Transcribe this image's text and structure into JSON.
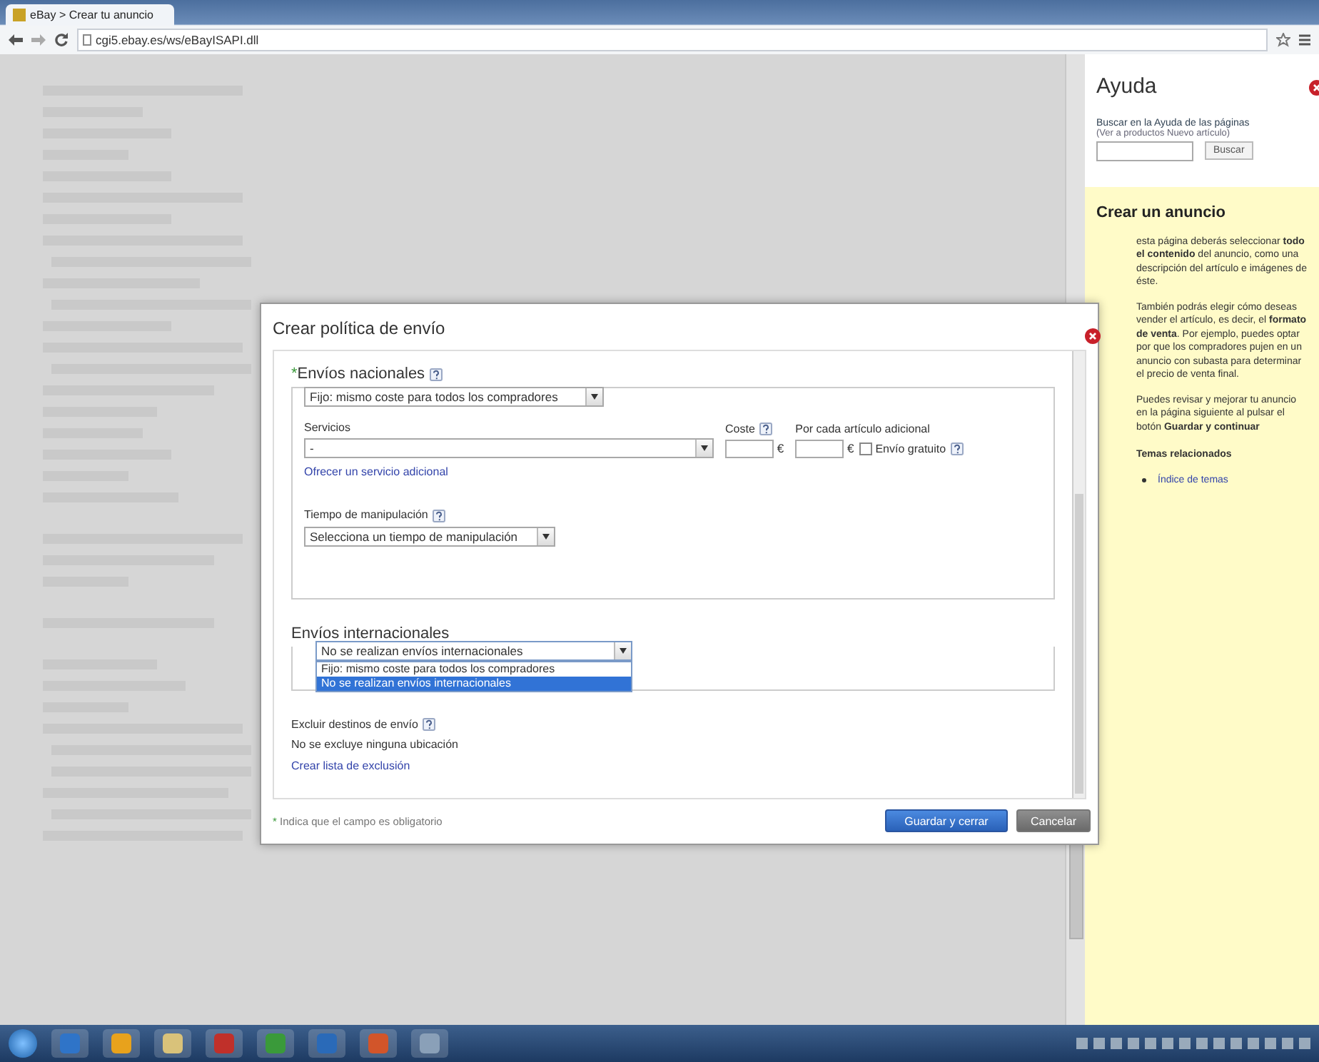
{
  "browser": {
    "tab_title": "eBay > Crear tu anuncio",
    "address": "cgi5.ebay.es/ws/eBayISAPI.dll"
  },
  "dialog": {
    "title": "Crear política de envío",
    "domestic": {
      "required_mark": "*",
      "title": "Envíos nacionales",
      "cost_type": "Fijo: mismo coste para todos los compradores",
      "services_label": "Servicios",
      "service_value": "-",
      "cost_label": "Coste",
      "additional_label": "Por cada artículo adicional",
      "currency_marks": [
        "€",
        "€"
      ],
      "free_shipping": {
        "label": "Envío gratuito",
        "checked": false
      },
      "add_service_link": "Ofrecer un servicio adicional",
      "handling_label": "Tiempo de manipulación",
      "handling_value": "Selecciona un tiempo de manipulación"
    },
    "international": {
      "title": "Envíos internacionales",
      "value": "No se realizan envíos internacionales",
      "open": true,
      "options": [
        {
          "label": "Fijo: mismo coste para todos los compradores",
          "selected": false
        },
        {
          "label": "No se realizan envíos internacionales",
          "selected": true
        }
      ]
    },
    "exclusions": {
      "label": "Excluir destinos de envío",
      "status": "No se excluye ninguna ubicación",
      "link": "Crear lista de exclusión"
    },
    "footer": {
      "marker": "*",
      "note": "Indica que el campo es obligatorio"
    },
    "buttons": [
      {
        "label": "Guardar y cerrar",
        "kind": "primary"
      },
      {
        "label": "Cancelar",
        "kind": "secondary"
      }
    ]
  },
  "help": {
    "title": "Ayuda",
    "search_label": "Buscar en la Ayuda de las páginas",
    "search_hint": "(Ver a productos Nuevo artículo)",
    "search_button": "Buscar",
    "topic_title": "Crear un anuncio",
    "paragraphs": [
      "esta página deberás seleccionar **todo el contenido** del anuncio, como una descripción del artículo e imágenes de éste.",
      "También podrás elegir cómo deseas vender el artículo, es decir, el **formato de venta**. Por ejemplo, puedes optar por que los compradores pujen en un anuncio con subasta para determinar el precio de venta final.",
      "Puedes revisar y mejorar tu anuncio en la página siguiente al pulsar el botón **Guardar y continuar**"
    ],
    "related_title": "Temas relacionados",
    "related_links": [
      "Índice de temas"
    ]
  }
}
